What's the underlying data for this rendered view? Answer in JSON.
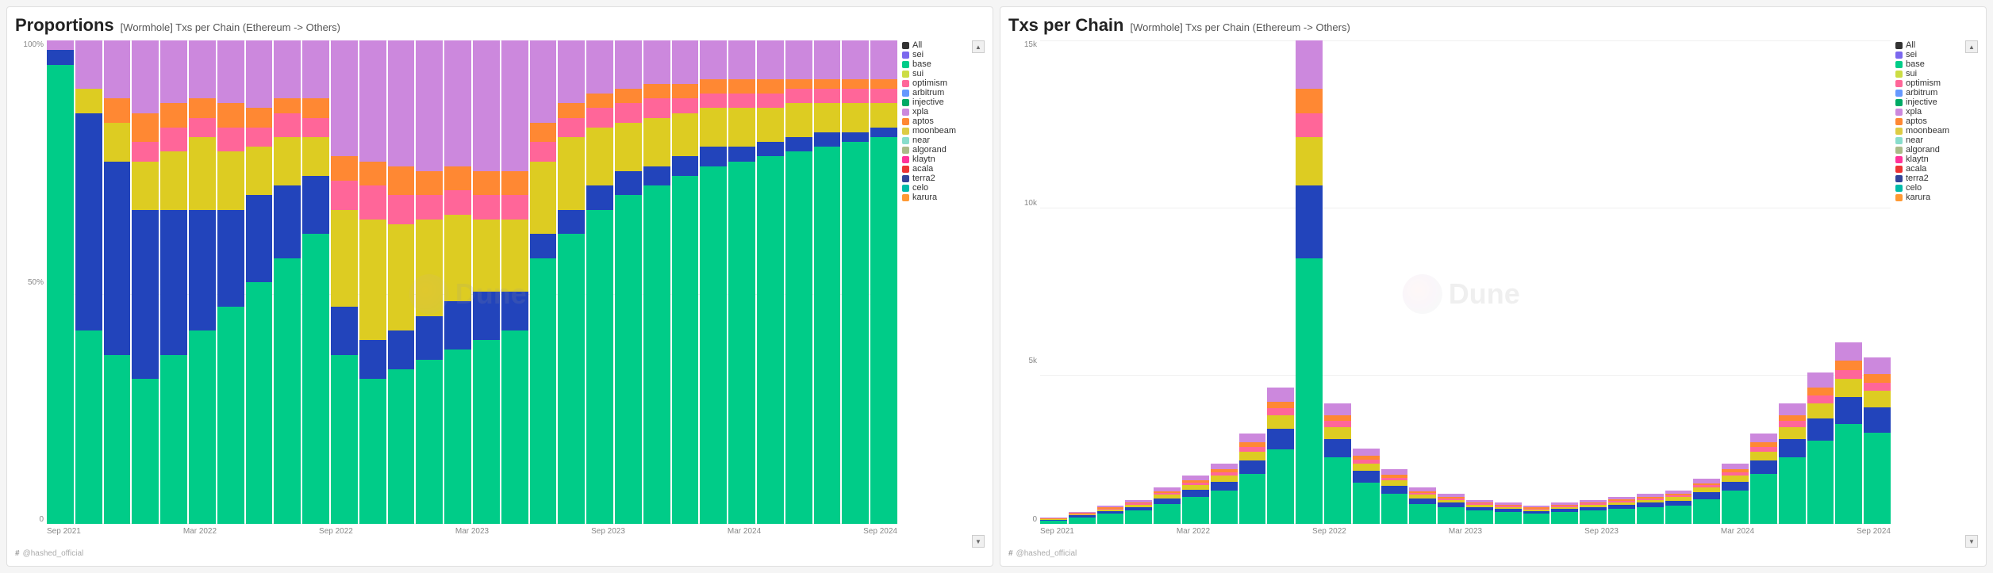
{
  "panel1": {
    "title": "Proportions",
    "subtitle": "[Wormhole] Txs per Chain (Ethereum -> Others)",
    "yLabels": [
      "100%",
      "50%",
      "0"
    ],
    "xLabels": [
      "Sep 2021",
      "Mar 2022",
      "Sep 2022",
      "Mar 2023",
      "Sep 2023",
      "Mar 2024",
      "Sep 2024"
    ],
    "footer": "@hashed_official",
    "watermark": "Dune"
  },
  "panel2": {
    "title": "Txs per Chain",
    "subtitle": "[Wormhole] Txs per Chain (Ethereum -> Others)",
    "yLabels": [
      "15k",
      "10k",
      "5k",
      "0"
    ],
    "xLabels": [
      "Sep 2021",
      "Mar 2022",
      "Sep 2022",
      "Mar 2023",
      "Sep 2023",
      "Mar 2024",
      "Sep 2024"
    ],
    "footer": "@hashed_official",
    "watermark": "Dune"
  },
  "legend": {
    "items": [
      {
        "label": "All",
        "color": "#333333"
      },
      {
        "label": "sei",
        "color": "#7B68EE"
      },
      {
        "label": "base",
        "color": "#00CC88"
      },
      {
        "label": "sui",
        "color": "#CCDD44"
      },
      {
        "label": "optimism",
        "color": "#FF6699"
      },
      {
        "label": "arbitrum",
        "color": "#6699FF"
      },
      {
        "label": "injective",
        "color": "#00AA66"
      },
      {
        "label": "xpla",
        "color": "#CC88DD"
      },
      {
        "label": "aptos",
        "color": "#FF8833"
      },
      {
        "label": "moonbeam",
        "color": "#DDCC44"
      },
      {
        "label": "near",
        "color": "#88DDCC"
      },
      {
        "label": "algorand",
        "color": "#AABB88"
      },
      {
        "label": "klaytn",
        "color": "#FF3399"
      },
      {
        "label": "acala",
        "color": "#EE3333"
      },
      {
        "label": "terra2",
        "color": "#334499"
      },
      {
        "label": "celo",
        "color": "#00BBAA"
      },
      {
        "label": "karura",
        "color": "#FF9933"
      }
    ]
  },
  "proportions_bars": [
    {
      "green": 95,
      "blue": 3,
      "other": 2
    },
    {
      "green": 40,
      "blue": 45,
      "yellow": 5,
      "other": 10
    },
    {
      "green": 35,
      "blue": 40,
      "yellow": 8,
      "orange": 5,
      "other": 12
    },
    {
      "green": 30,
      "blue": 35,
      "yellow": 10,
      "pink": 4,
      "orange": 6,
      "other": 15
    },
    {
      "green": 35,
      "blue": 30,
      "yellow": 12,
      "pink": 5,
      "orange": 5,
      "other": 13
    },
    {
      "green": 40,
      "blue": 25,
      "yellow": 15,
      "pink": 4,
      "orange": 4,
      "other": 12
    },
    {
      "green": 45,
      "blue": 20,
      "yellow": 12,
      "pink": 5,
      "orange": 5,
      "other": 13
    },
    {
      "green": 50,
      "blue": 18,
      "yellow": 10,
      "pink": 4,
      "orange": 4,
      "other": 14
    },
    {
      "green": 55,
      "blue": 15,
      "yellow": 10,
      "pink": 5,
      "orange": 3,
      "other": 12
    },
    {
      "green": 60,
      "blue": 12,
      "yellow": 8,
      "pink": 4,
      "orange": 4,
      "other": 12
    },
    {
      "green": 35,
      "blue": 10,
      "yellow": 20,
      "pink": 6,
      "orange": 5,
      "other": 24
    },
    {
      "green": 30,
      "blue": 8,
      "yellow": 25,
      "pink": 7,
      "orange": 5,
      "other": 25
    },
    {
      "green": 32,
      "blue": 8,
      "yellow": 22,
      "pink": 6,
      "orange": 6,
      "other": 26
    },
    {
      "green": 34,
      "blue": 9,
      "yellow": 20,
      "pink": 5,
      "orange": 5,
      "other": 27
    },
    {
      "green": 36,
      "blue": 10,
      "yellow": 18,
      "pink": 5,
      "orange": 5,
      "other": 26
    },
    {
      "green": 38,
      "blue": 10,
      "yellow": 15,
      "pink": 5,
      "orange": 5,
      "other": 27
    },
    {
      "green": 40,
      "blue": 8,
      "yellow": 15,
      "pink": 5,
      "orange": 5,
      "other": 27
    },
    {
      "green": 55,
      "blue": 5,
      "yellow": 15,
      "pink": 4,
      "orange": 4,
      "other": 17
    },
    {
      "green": 60,
      "blue": 5,
      "yellow": 15,
      "pink": 4,
      "orange": 3,
      "other": 13
    },
    {
      "green": 65,
      "blue": 5,
      "yellow": 12,
      "pink": 4,
      "orange": 3,
      "other": 11
    },
    {
      "green": 68,
      "blue": 5,
      "yellow": 10,
      "pink": 4,
      "orange": 3,
      "other": 10
    },
    {
      "green": 70,
      "blue": 4,
      "yellow": 10,
      "pink": 4,
      "orange": 3,
      "other": 9
    },
    {
      "green": 72,
      "blue": 4,
      "yellow": 9,
      "pink": 3,
      "orange": 3,
      "other": 9
    },
    {
      "green": 74,
      "blue": 4,
      "yellow": 8,
      "pink": 3,
      "orange": 3,
      "other": 8
    },
    {
      "green": 75,
      "blue": 3,
      "yellow": 8,
      "pink": 3,
      "orange": 3,
      "other": 8
    },
    {
      "green": 76,
      "blue": 3,
      "yellow": 7,
      "pink": 3,
      "orange": 3,
      "other": 8
    },
    {
      "green": 77,
      "blue": 3,
      "yellow": 7,
      "pink": 3,
      "orange": 2,
      "other": 8
    },
    {
      "green": 78,
      "blue": 3,
      "yellow": 6,
      "pink": 3,
      "orange": 2,
      "other": 8
    },
    {
      "green": 79,
      "blue": 2,
      "yellow": 6,
      "pink": 3,
      "orange": 2,
      "other": 8
    },
    {
      "green": 80,
      "blue": 2,
      "yellow": 5,
      "pink": 3,
      "orange": 2,
      "other": 8
    }
  ],
  "txs_bars_heights": [
    200,
    400,
    600,
    800,
    1200,
    1600,
    2000,
    3000,
    4500,
    16000,
    4000,
    2500,
    1800,
    1200,
    1000,
    800,
    700,
    600,
    700,
    800,
    900,
    1000,
    1100,
    1500,
    2000,
    3000,
    4000,
    5000,
    6000,
    5500
  ]
}
